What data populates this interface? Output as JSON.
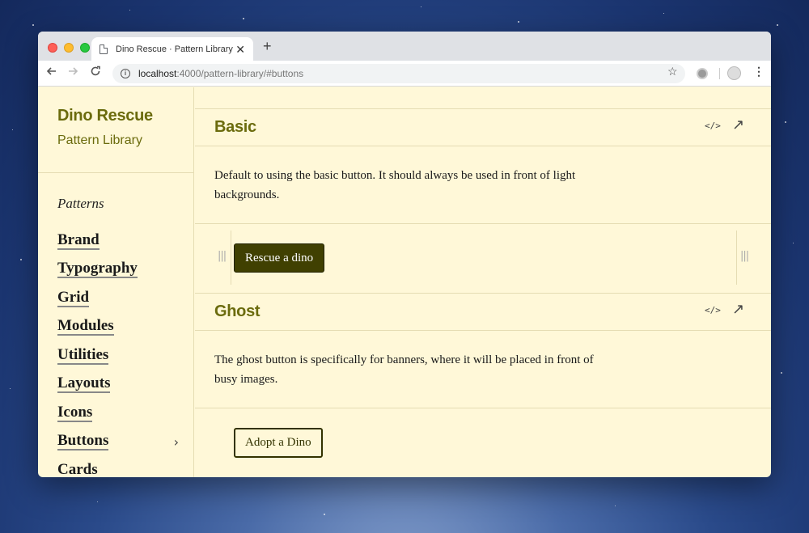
{
  "browser": {
    "tab_title": "Dino Rescue · Pattern Library",
    "tab_close": "✕",
    "new_tab": "+",
    "url_host": "localhost",
    "url_path": ":4000/pattern-library/#buttons",
    "icons": [
      "back-icon",
      "forward-icon",
      "reload-icon",
      "info-icon",
      "bookmark-star-icon",
      "extension-icon",
      "profile-icon",
      "menu-icon"
    ]
  },
  "sidebar": {
    "brand_name": "Dino Rescue",
    "brand_sub": "Pattern Library",
    "patterns_label": "Patterns",
    "items": [
      {
        "label": "Brand"
      },
      {
        "label": "Typography"
      },
      {
        "label": "Grid"
      },
      {
        "label": "Modules"
      },
      {
        "label": "Utilities"
      },
      {
        "label": "Layouts"
      },
      {
        "label": "Icons"
      },
      {
        "label": "Buttons",
        "chevron": "›"
      },
      {
        "label": "Cards"
      }
    ]
  },
  "main": {
    "sections": [
      {
        "title": "Basic",
        "description": "Default to using the basic button. It should always be used in front of light backgrounds.",
        "button_label": "Rescue a dino"
      },
      {
        "title": "Ghost",
        "description": "The ghost button is specifically for banners, where it will be placed in front of busy images.",
        "button_label": "Adopt a Dino"
      }
    ],
    "code_icon_glyph": "</>",
    "link_icon_glyph": "↗",
    "handle_glyph": "|||"
  },
  "colors": {
    "page_bg": "#fff8d8",
    "brand_olive": "#6b6b0d",
    "button_dark": "#404001"
  }
}
